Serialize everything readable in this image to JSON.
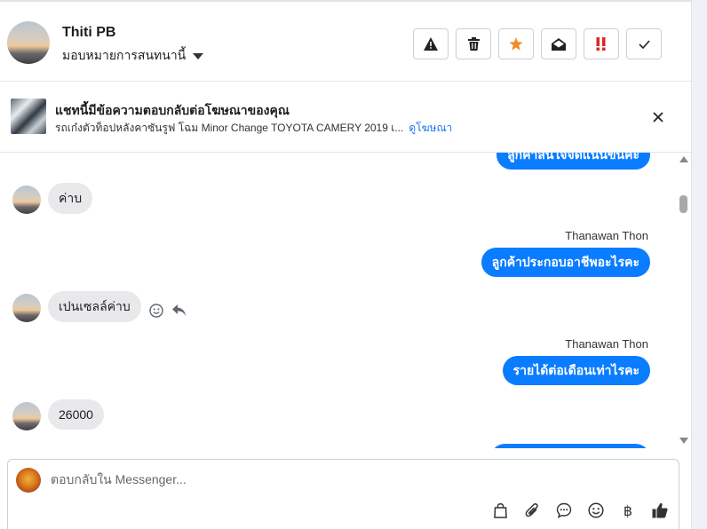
{
  "header": {
    "contact_name": "Thiti PB",
    "assign_label": "มอบหมายการสนทนานี้",
    "toolbar": [
      {
        "icon": "warning-icon",
        "action": "report"
      },
      {
        "icon": "trash-icon",
        "action": "delete"
      },
      {
        "icon": "star-icon",
        "action": "star",
        "color": "#f28c28"
      },
      {
        "icon": "envelope-open-icon",
        "action": "mark-unread"
      },
      {
        "icon": "priority-icon",
        "action": "priority",
        "color": "#e02424"
      },
      {
        "icon": "check-icon",
        "action": "done"
      }
    ]
  },
  "banner": {
    "title": "แชทนี้มีข้อความตอบกลับต่อโฆษณาของคุณ",
    "subtitle": "รถเก๋งตัวท็อปหลังคาซันรูฟ โฉม Minor Change TOYOTA CAMERY 2019 เ...",
    "link_label": "ดูโฆษณา"
  },
  "messages": {
    "partial_top_text": "ลูกค้าสนใจจัดแน่นขึ้นคะ",
    "items": [
      {
        "direction": "in",
        "text": "ค่าบ"
      },
      {
        "direction": "out",
        "sender": "Thanawan Thon",
        "text": "ลูกค้าประกอบอาชีพอะไรคะ"
      },
      {
        "direction": "in",
        "text": "เปนเซลล์ค่าบ"
      },
      {
        "direction": "out",
        "sender": "Thanawan Thon",
        "text": "รายได้ต่อเดือนเท่าไรคะ"
      },
      {
        "direction": "in",
        "text": "26000"
      }
    ]
  },
  "composer": {
    "placeholder": "ตอบกลับใน Messenger...",
    "tools": [
      "bag-icon",
      "paperclip-icon",
      "chat-bubble-icon",
      "emoji-icon",
      "baht-icon",
      "thumbs-up-icon"
    ],
    "baht_glyph": "฿"
  },
  "colors": {
    "accent": "#0a7cff",
    "incoming_bubble": "#e9e9eb",
    "link": "#1877f2"
  }
}
